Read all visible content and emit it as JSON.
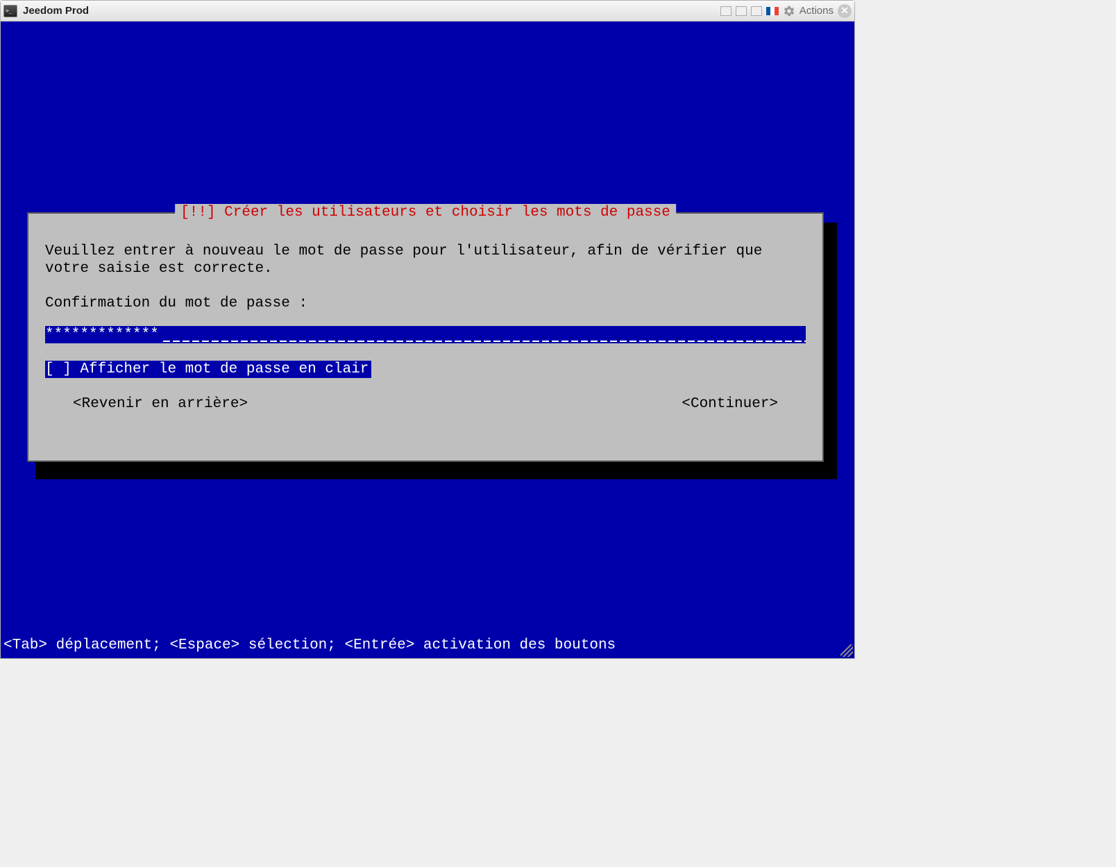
{
  "window": {
    "title": "Jeedom Prod",
    "actions_label": "Actions"
  },
  "dialog": {
    "title": "[!!] Créer les utilisateurs et choisir les mots de passe",
    "instruction": "Veuillez entrer à nouveau le mot de passe pour l'utilisateur, afin de vérifier que votre saisie est correcte.",
    "prompt": "Confirmation du mot de passe :",
    "password_value": "*************",
    "checkbox_state": "[ ]",
    "checkbox_label": "Afficher le mot de passe en clair",
    "back_button": "<Revenir en arrière>",
    "continue_button": "<Continuer>"
  },
  "footer": {
    "help": "<Tab> déplacement; <Espace> sélection; <Entrée> activation des boutons"
  }
}
